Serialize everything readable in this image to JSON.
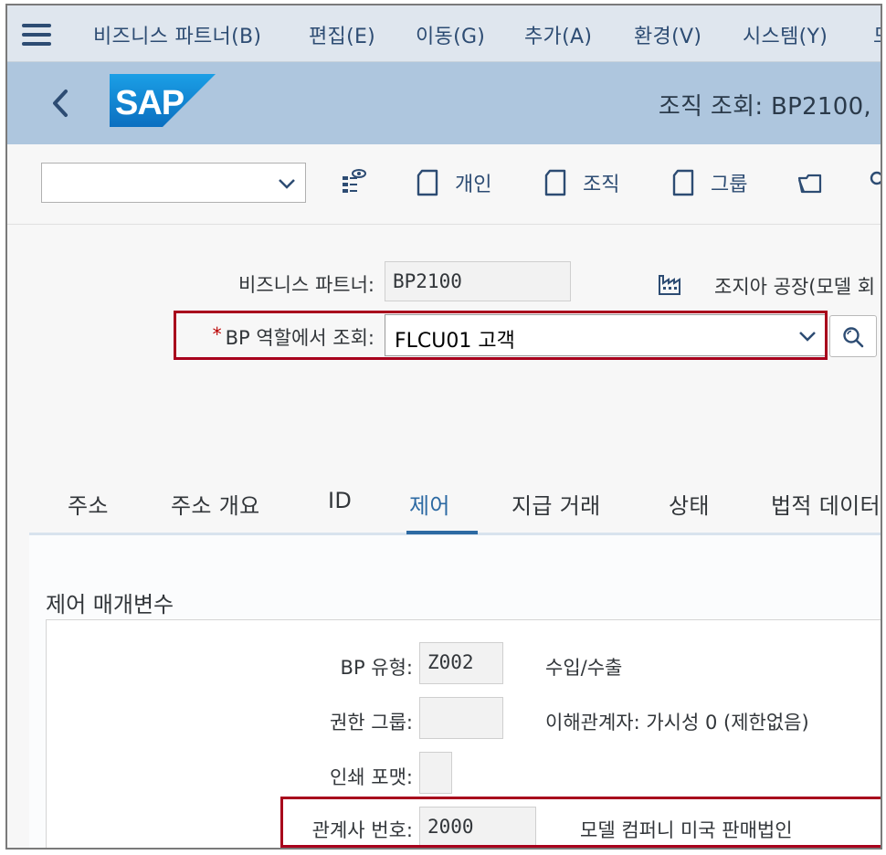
{
  "menubar": {
    "items": [
      "비즈니스 파트너(B)",
      "편집(E)",
      "이동(G)",
      "추가(A)",
      "환경(V)",
      "시스템(Y)",
      "도"
    ]
  },
  "header": {
    "title": "조직 조회: BP2100,"
  },
  "toolbar": {
    "dropdown_value": "",
    "buttons": [
      "개인",
      "조직",
      "그룹"
    ]
  },
  "form": {
    "bp_label": "비즈니스 파트너:",
    "bp_value": "BP2100",
    "org_name": "조지아 공장(모델 회",
    "role_label": "BP 역할에서 조회:",
    "role_value": "FLCU01 고객",
    "required_mark": "*"
  },
  "tabs": [
    "주소",
    "주소 개요",
    "ID",
    "제어",
    "지급 거래",
    "상태",
    "법적 데이터"
  ],
  "section": {
    "title": "제어 매개변수",
    "fields": [
      {
        "label": "BP 유형:",
        "value": "Z002",
        "desc": "수입/수출"
      },
      {
        "label": "권한 그룹:",
        "value": "",
        "desc": "이해관계자: 가시성 0 (제한없음)"
      },
      {
        "label": "인쇄 포맷:",
        "value": "",
        "desc": ""
      },
      {
        "label": "관계사 번호:",
        "value": "2000",
        "desc": "모델 컴퍼니 미국 판매법인"
      }
    ]
  },
  "colors": {
    "header_bg": "#aec6de",
    "menubar_bg": "#dfe6ee",
    "active_tab": "#2d6aa3",
    "highlight_box": "#a8001c",
    "sap_blue": "#1e88d6"
  }
}
